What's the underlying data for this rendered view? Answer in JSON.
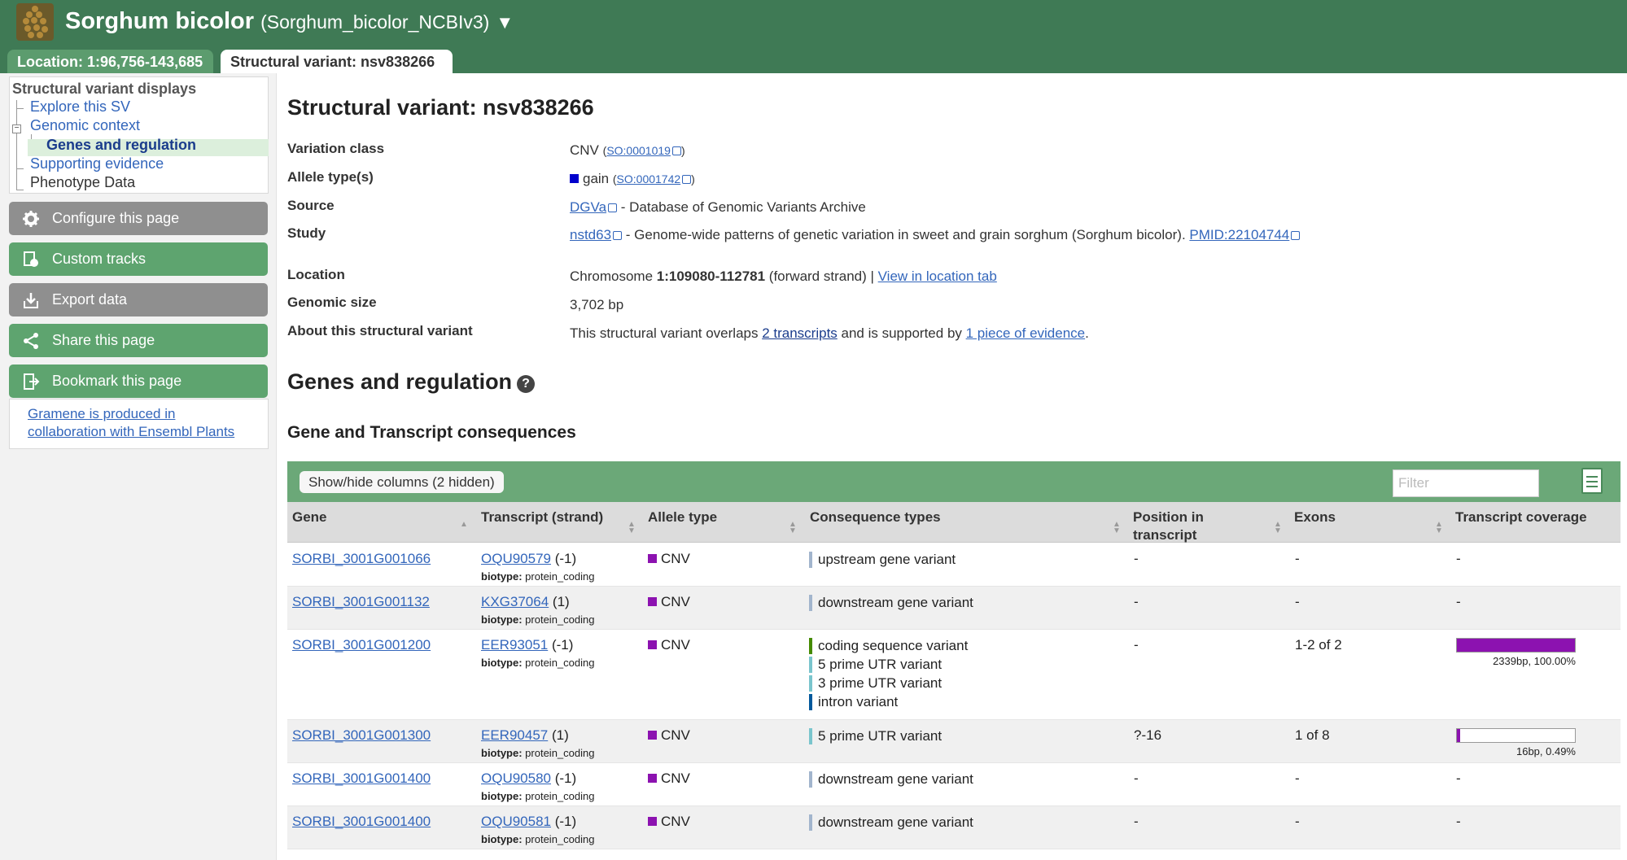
{
  "header": {
    "species": "Sorghum bicolor",
    "assembly": "(Sorghum_bicolor_NCBIv3)",
    "caret": "▼",
    "tabs": [
      {
        "label": "Location: 1:96,756-143,685"
      },
      {
        "label": "Structural variant: nsv838266"
      }
    ]
  },
  "sidebar": {
    "nav_title": "Structural variant displays",
    "nav_items": [
      {
        "label": "Explore this SV"
      },
      {
        "label": "Genomic context"
      },
      {
        "label": "Genes and regulation"
      },
      {
        "label": "Supporting evidence"
      },
      {
        "label": "Phenotype Data"
      }
    ],
    "collapse_symbol": "−",
    "buttons": [
      {
        "label": "Configure this page",
        "icon": "gear-icon"
      },
      {
        "label": "Custom tracks",
        "icon": "custom-tracks-icon"
      },
      {
        "label": "Export data",
        "icon": "export-icon"
      },
      {
        "label": "Share this page",
        "icon": "share-icon"
      },
      {
        "label": "Bookmark this page",
        "icon": "bookmark-icon"
      }
    ],
    "credit_line1": "Gramene is produced in",
    "credit_line2": "collaboration with Ensembl Plants"
  },
  "main": {
    "title": "Structural variant: nsv838266",
    "summary": {
      "variation_class_label": "Variation class",
      "variation_class_value": "CNV",
      "variation_class_so": "SO:0001019",
      "allele_label": "Allele type(s)",
      "allele_value": "gain",
      "allele_so": "SO:0001742",
      "allele_color": "#0000cc",
      "source_label": "Source",
      "source_link": "DGVa",
      "source_text": " - Database of Genomic Variants Archive",
      "study_label": "Study",
      "study_link": "nstd63",
      "study_text": " - Genome-wide patterns of genetic variation in sweet and grain sorghum (Sorghum bicolor).",
      "study_pmid": "PMID:22104744",
      "location_label": "Location",
      "location_prefix": "Chromosome ",
      "location_coords": "1:109080-112781",
      "location_strand": " (forward strand) | ",
      "location_link": "View in location tab",
      "size_label": "Genomic size",
      "size_value": "3,702 bp",
      "about_label": "About this structural variant",
      "about_text1": "This structural variant overlaps ",
      "about_link1": "2 transcripts",
      "about_text2": " and is supported by ",
      "about_link2": "1 piece of evidence",
      "about_text3": "."
    },
    "section_title": "Genes and regulation",
    "help_symbol": "?",
    "subsection_title": "Gene and Transcript consequences",
    "table": {
      "show_hide_label": "Show/hide columns (2 hidden)",
      "filter_placeholder": "Filter",
      "columns": [
        "Gene",
        "Transcript (strand)",
        "Allele type",
        "Consequence types",
        "Position in transcript",
        "Exons",
        "Transcript coverage"
      ],
      "cnv_color": "#8c12b0",
      "rows": [
        {
          "gene": "SORBI_3001G001066",
          "transcript": "OQU90579",
          "strand": " (-1)",
          "biotype_label": "biotype:",
          "biotype": " protein_coding",
          "allele": "CNV",
          "consequences": [
            {
              "label": "upstream gene variant",
              "color": "#a2b5cd"
            }
          ],
          "position": "-",
          "exons": "-",
          "coverage": "-"
        },
        {
          "gene": "SORBI_3001G001132",
          "transcript": "KXG37064",
          "strand": " (1)",
          "biotype_label": "biotype:",
          "biotype": " protein_coding",
          "allele": "CNV",
          "consequences": [
            {
              "label": "downstream gene variant",
              "color": "#a2b5cd"
            }
          ],
          "position": "-",
          "exons": "-",
          "coverage": "-"
        },
        {
          "gene": "SORBI_3001G001200",
          "transcript": "EER93051",
          "strand": " (-1)",
          "biotype_label": "biotype:",
          "biotype": " protein_coding",
          "allele": "CNV",
          "consequences": [
            {
              "label": "coding sequence variant",
              "color": "#458b00"
            },
            {
              "label": "5 prime UTR variant",
              "color": "#7ac5cd"
            },
            {
              "label": "3 prime UTR variant",
              "color": "#7ac5cd"
            },
            {
              "label": "intron variant",
              "color": "#02599c"
            }
          ],
          "position": "-",
          "exons": "1-2 of 2",
          "coverage_fraction": 1.0,
          "coverage_label": "2339bp, 100.00%"
        },
        {
          "gene": "SORBI_3001G001300",
          "transcript": "EER90457",
          "strand": " (1)",
          "biotype_label": "biotype:",
          "biotype": " protein_coding",
          "allele": "CNV",
          "consequences": [
            {
              "label": "5 prime UTR variant",
              "color": "#7ac5cd"
            }
          ],
          "position": "?-16",
          "exons": "1 of 8",
          "coverage_fraction": 0.0049,
          "coverage_label": "16bp, 0.49%"
        },
        {
          "gene": "SORBI_3001G001400",
          "transcript": "OQU90580",
          "strand": " (-1)",
          "biotype_label": "biotype:",
          "biotype": " protein_coding",
          "allele": "CNV",
          "consequences": [
            {
              "label": "downstream gene variant",
              "color": "#a2b5cd"
            }
          ],
          "position": "-",
          "exons": "-",
          "coverage": "-"
        },
        {
          "gene": "SORBI_3001G001400",
          "transcript": "OQU90581",
          "strand": " (-1)",
          "biotype_label": "biotype:",
          "biotype": " protein_coding",
          "allele": "CNV",
          "consequences": [
            {
              "label": "downstream gene variant",
              "color": "#a2b5cd"
            }
          ],
          "position": "-",
          "exons": "-",
          "coverage": "-"
        }
      ]
    }
  }
}
